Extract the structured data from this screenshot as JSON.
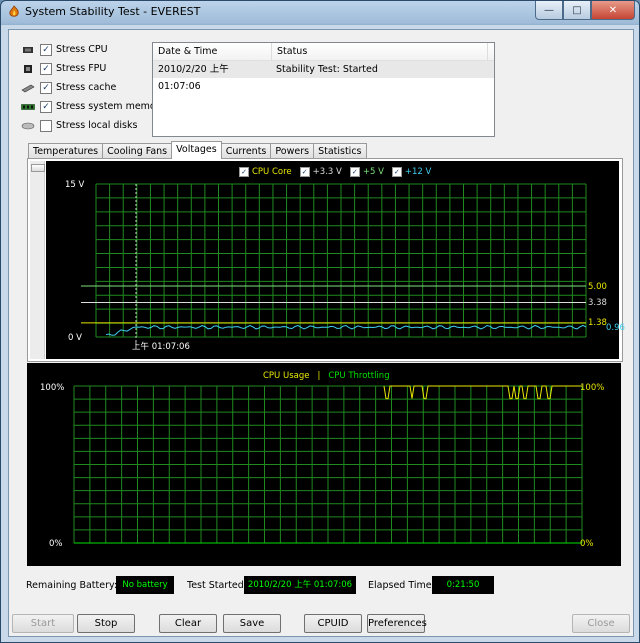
{
  "window": {
    "title": "System Stability Test - EVEREST"
  },
  "stress_options": [
    {
      "label": "Stress CPU",
      "checked": true,
      "icon": "cpu-icon"
    },
    {
      "label": "Stress FPU",
      "checked": true,
      "icon": "fpu-icon"
    },
    {
      "label": "Stress cache",
      "checked": true,
      "icon": "cache-icon"
    },
    {
      "label": "Stress system memory",
      "checked": true,
      "icon": "memory-icon"
    },
    {
      "label": "Stress local disks",
      "checked": false,
      "icon": "disk-icon"
    }
  ],
  "log": {
    "headers": [
      "Date & Time",
      "Status"
    ],
    "rows": [
      {
        "datetime": "2010/2/20 上午 01:07:06",
        "status": "Stability Test: Started"
      }
    ]
  },
  "tabs": [
    "Temperatures",
    "Cooling Fans",
    "Voltages",
    "Currents",
    "Powers",
    "Statistics"
  ],
  "active_tab": "Voltages",
  "chart_data": [
    {
      "type": "line",
      "legend": [
        "CPU Core",
        "+3.3 V",
        "+5 V",
        "+12 V"
      ],
      "ylim": [
        0,
        15
      ],
      "y_top_label": "15 V",
      "y_bottom_label": "0 V",
      "x_label": "上午 01:07:06",
      "colors": {
        "cpu_core": "#e8e800",
        "v33": "#dcdcdc",
        "v5": "#7ee07e",
        "v12": "#3fd0f0",
        "grid": "#1f8a1f",
        "marker": "#cccccc"
      },
      "series": [
        {
          "name": "CPU Core",
          "last_value": 1.38,
          "label": "1.38"
        },
        {
          "name": "+3.3 V",
          "last_value": 3.38,
          "label": "3.38"
        },
        {
          "name": "+5 V",
          "last_value": 5.0,
          "label": "5.00"
        },
        {
          "name": "+12 V",
          "last_value": 0.96,
          "label": "0.96"
        }
      ]
    },
    {
      "type": "line",
      "legend": [
        "CPU Usage",
        "CPU Throttling"
      ],
      "ylim": [
        0,
        100
      ],
      "y_top_label": "100%",
      "y_bottom_label": "0%",
      "colors": {
        "usage": "#e8e800",
        "throttling": "#00e000",
        "grid": "#1f8a1f"
      },
      "series": [
        {
          "name": "CPU Usage",
          "last_value": 100,
          "label": "100%"
        },
        {
          "name": "CPU Throttling",
          "last_value": 0,
          "label": "0%"
        }
      ]
    }
  ],
  "status": {
    "battery_label": "Remaining Battery:",
    "battery_value": "No battery",
    "started_label": "Test Started:",
    "started_value": "2010/2/20 上午 01:07:06",
    "elapsed_label": "Elapsed Time:",
    "elapsed_value": "0:21:50"
  },
  "buttons": {
    "start": "Start",
    "stop": "Stop",
    "clear": "Clear",
    "save": "Save",
    "cpuid": "CPUID",
    "preferences": "Preferences",
    "close": "Close"
  }
}
